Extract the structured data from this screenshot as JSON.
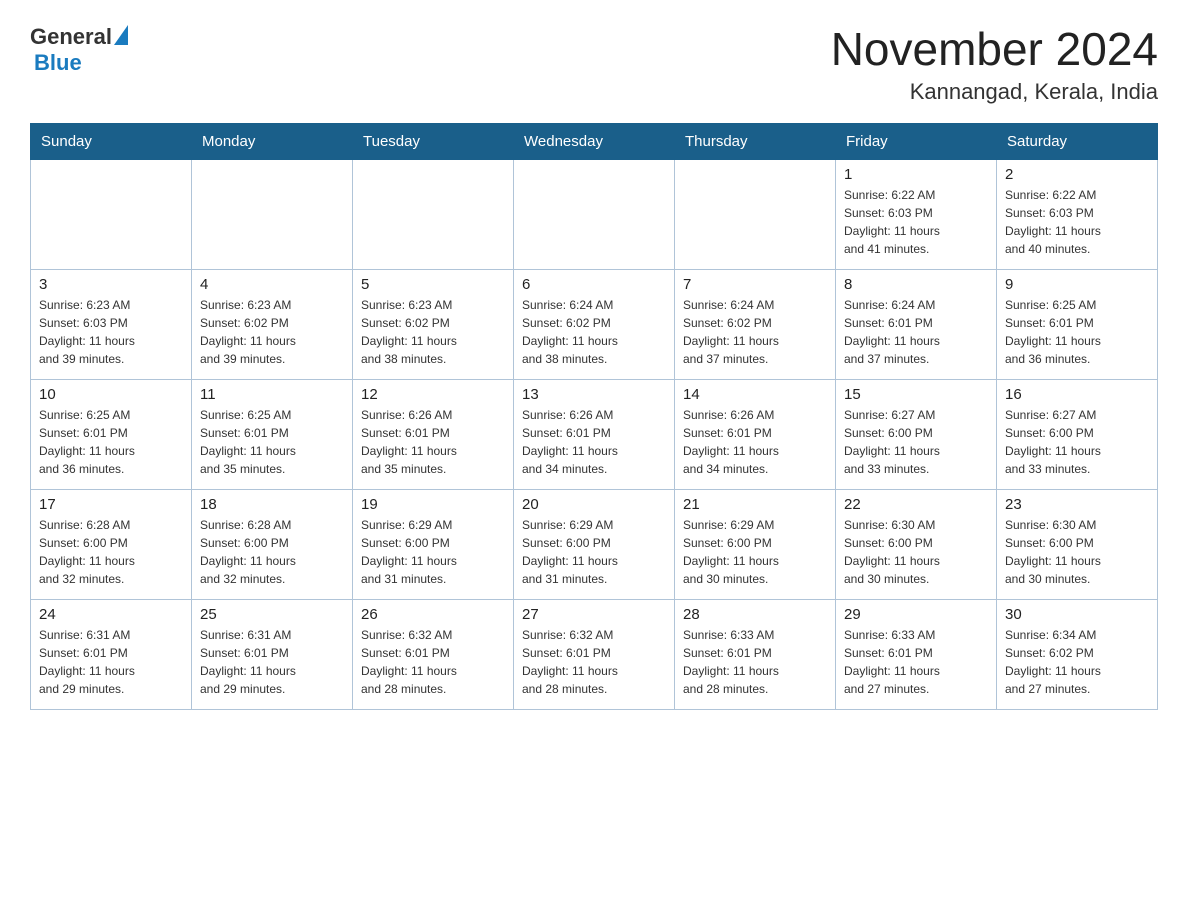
{
  "header": {
    "logo_general": "General",
    "logo_blue": "Blue",
    "month_title": "November 2024",
    "location": "Kannangad, Kerala, India"
  },
  "weekdays": [
    "Sunday",
    "Monday",
    "Tuesday",
    "Wednesday",
    "Thursday",
    "Friday",
    "Saturday"
  ],
  "weeks": [
    [
      {
        "day": "",
        "info": ""
      },
      {
        "day": "",
        "info": ""
      },
      {
        "day": "",
        "info": ""
      },
      {
        "day": "",
        "info": ""
      },
      {
        "day": "",
        "info": ""
      },
      {
        "day": "1",
        "info": "Sunrise: 6:22 AM\nSunset: 6:03 PM\nDaylight: 11 hours\nand 41 minutes."
      },
      {
        "day": "2",
        "info": "Sunrise: 6:22 AM\nSunset: 6:03 PM\nDaylight: 11 hours\nand 40 minutes."
      }
    ],
    [
      {
        "day": "3",
        "info": "Sunrise: 6:23 AM\nSunset: 6:03 PM\nDaylight: 11 hours\nand 39 minutes."
      },
      {
        "day": "4",
        "info": "Sunrise: 6:23 AM\nSunset: 6:02 PM\nDaylight: 11 hours\nand 39 minutes."
      },
      {
        "day": "5",
        "info": "Sunrise: 6:23 AM\nSunset: 6:02 PM\nDaylight: 11 hours\nand 38 minutes."
      },
      {
        "day": "6",
        "info": "Sunrise: 6:24 AM\nSunset: 6:02 PM\nDaylight: 11 hours\nand 38 minutes."
      },
      {
        "day": "7",
        "info": "Sunrise: 6:24 AM\nSunset: 6:02 PM\nDaylight: 11 hours\nand 37 minutes."
      },
      {
        "day": "8",
        "info": "Sunrise: 6:24 AM\nSunset: 6:01 PM\nDaylight: 11 hours\nand 37 minutes."
      },
      {
        "day": "9",
        "info": "Sunrise: 6:25 AM\nSunset: 6:01 PM\nDaylight: 11 hours\nand 36 minutes."
      }
    ],
    [
      {
        "day": "10",
        "info": "Sunrise: 6:25 AM\nSunset: 6:01 PM\nDaylight: 11 hours\nand 36 minutes."
      },
      {
        "day": "11",
        "info": "Sunrise: 6:25 AM\nSunset: 6:01 PM\nDaylight: 11 hours\nand 35 minutes."
      },
      {
        "day": "12",
        "info": "Sunrise: 6:26 AM\nSunset: 6:01 PM\nDaylight: 11 hours\nand 35 minutes."
      },
      {
        "day": "13",
        "info": "Sunrise: 6:26 AM\nSunset: 6:01 PM\nDaylight: 11 hours\nand 34 minutes."
      },
      {
        "day": "14",
        "info": "Sunrise: 6:26 AM\nSunset: 6:01 PM\nDaylight: 11 hours\nand 34 minutes."
      },
      {
        "day": "15",
        "info": "Sunrise: 6:27 AM\nSunset: 6:00 PM\nDaylight: 11 hours\nand 33 minutes."
      },
      {
        "day": "16",
        "info": "Sunrise: 6:27 AM\nSunset: 6:00 PM\nDaylight: 11 hours\nand 33 minutes."
      }
    ],
    [
      {
        "day": "17",
        "info": "Sunrise: 6:28 AM\nSunset: 6:00 PM\nDaylight: 11 hours\nand 32 minutes."
      },
      {
        "day": "18",
        "info": "Sunrise: 6:28 AM\nSunset: 6:00 PM\nDaylight: 11 hours\nand 32 minutes."
      },
      {
        "day": "19",
        "info": "Sunrise: 6:29 AM\nSunset: 6:00 PM\nDaylight: 11 hours\nand 31 minutes."
      },
      {
        "day": "20",
        "info": "Sunrise: 6:29 AM\nSunset: 6:00 PM\nDaylight: 11 hours\nand 31 minutes."
      },
      {
        "day": "21",
        "info": "Sunrise: 6:29 AM\nSunset: 6:00 PM\nDaylight: 11 hours\nand 30 minutes."
      },
      {
        "day": "22",
        "info": "Sunrise: 6:30 AM\nSunset: 6:00 PM\nDaylight: 11 hours\nand 30 minutes."
      },
      {
        "day": "23",
        "info": "Sunrise: 6:30 AM\nSunset: 6:00 PM\nDaylight: 11 hours\nand 30 minutes."
      }
    ],
    [
      {
        "day": "24",
        "info": "Sunrise: 6:31 AM\nSunset: 6:01 PM\nDaylight: 11 hours\nand 29 minutes."
      },
      {
        "day": "25",
        "info": "Sunrise: 6:31 AM\nSunset: 6:01 PM\nDaylight: 11 hours\nand 29 minutes."
      },
      {
        "day": "26",
        "info": "Sunrise: 6:32 AM\nSunset: 6:01 PM\nDaylight: 11 hours\nand 28 minutes."
      },
      {
        "day": "27",
        "info": "Sunrise: 6:32 AM\nSunset: 6:01 PM\nDaylight: 11 hours\nand 28 minutes."
      },
      {
        "day": "28",
        "info": "Sunrise: 6:33 AM\nSunset: 6:01 PM\nDaylight: 11 hours\nand 28 minutes."
      },
      {
        "day": "29",
        "info": "Sunrise: 6:33 AM\nSunset: 6:01 PM\nDaylight: 11 hours\nand 27 minutes."
      },
      {
        "day": "30",
        "info": "Sunrise: 6:34 AM\nSunset: 6:02 PM\nDaylight: 11 hours\nand 27 minutes."
      }
    ]
  ]
}
